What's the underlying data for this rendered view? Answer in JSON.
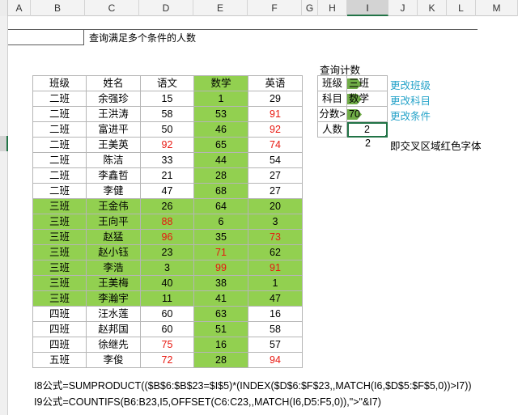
{
  "columns": [
    "A",
    "B",
    "C",
    "D",
    "E",
    "F",
    "G",
    "H",
    "I",
    "J",
    "K",
    "L",
    "M"
  ],
  "selected_column": "I",
  "caption": "查询满足多个条件的人数",
  "table": {
    "headers": [
      "班级",
      "姓名",
      "语文",
      "数学",
      "英语"
    ],
    "rows": [
      {
        "class": "二班",
        "name": "余强珍",
        "chinese": "15",
        "math": "1",
        "english": "29",
        "red": [],
        "highlight": false
      },
      {
        "class": "二班",
        "name": "王洪涛",
        "chinese": "58",
        "math": "53",
        "english": "91",
        "red": [
          "english"
        ],
        "highlight": false
      },
      {
        "class": "二班",
        "name": "富进平",
        "chinese": "50",
        "math": "46",
        "english": "92",
        "red": [
          "english"
        ],
        "highlight": false
      },
      {
        "class": "二班",
        "name": "王美英",
        "chinese": "92",
        "math": "65",
        "english": "74",
        "red": [
          "chinese",
          "english"
        ],
        "highlight": false
      },
      {
        "class": "二班",
        "name": "陈洁",
        "chinese": "33",
        "math": "44",
        "english": "54",
        "red": [],
        "highlight": false
      },
      {
        "class": "二班",
        "name": "李鑫哲",
        "chinese": "21",
        "math": "28",
        "english": "27",
        "red": [],
        "highlight": false
      },
      {
        "class": "二班",
        "name": "李健",
        "chinese": "47",
        "math": "68",
        "english": "27",
        "red": [],
        "highlight": false
      },
      {
        "class": "三班",
        "name": "王金伟",
        "chinese": "26",
        "math": "64",
        "english": "20",
        "red": [],
        "highlight": true
      },
      {
        "class": "三班",
        "name": "王向平",
        "chinese": "88",
        "math": "6",
        "english": "3",
        "red": [
          "chinese"
        ],
        "highlight": true
      },
      {
        "class": "三班",
        "name": "赵猛",
        "chinese": "96",
        "math": "35",
        "english": "73",
        "red": [
          "chinese",
          "english"
        ],
        "highlight": true
      },
      {
        "class": "三班",
        "name": "赵小钰",
        "chinese": "23",
        "math": "71",
        "english": "62",
        "red": [
          "math"
        ],
        "highlight": true
      },
      {
        "class": "三班",
        "name": "李浩",
        "chinese": "3",
        "math": "99",
        "english": "91",
        "red": [
          "math",
          "english"
        ],
        "highlight": true
      },
      {
        "class": "三班",
        "name": "王美梅",
        "chinese": "40",
        "math": "38",
        "english": "1",
        "red": [],
        "highlight": true
      },
      {
        "class": "三班",
        "name": "李瀚宇",
        "chinese": "11",
        "math": "41",
        "english": "47",
        "red": [],
        "highlight": true
      },
      {
        "class": "四班",
        "name": "汪水莲",
        "chinese": "60",
        "math": "63",
        "english": "16",
        "red": [],
        "highlight": false
      },
      {
        "class": "四班",
        "name": "赵邦国",
        "chinese": "60",
        "math": "51",
        "english": "58",
        "red": [],
        "highlight": false
      },
      {
        "class": "四班",
        "name": "徐继先",
        "chinese": "75",
        "math": "16",
        "english": "57",
        "red": [
          "chinese"
        ],
        "highlight": false
      },
      {
        "class": "五班",
        "name": "李俊",
        "chinese": "72",
        "math": "28",
        "english": "94",
        "red": [
          "chinese",
          "english"
        ],
        "highlight": false
      }
    ]
  },
  "query": {
    "title": "查询计数",
    "rows": [
      {
        "label": "班级",
        "value": "三班",
        "link": "更改班级"
      },
      {
        "label": "科目",
        "value": "数学",
        "link": "更改科目"
      },
      {
        "label": "分数>",
        "value": "70",
        "link": "更改条件"
      },
      {
        "label": "人数",
        "value": "2",
        "link": ""
      }
    ],
    "i9_value": "2",
    "i9_note": "即交叉区域红色字体"
  },
  "formulas": [
    "I8公式=SUMPRODUCT(($B$6:$B$23=$I$5)*(INDEX($D$6:$F$23,,MATCH(I6,$D$5:$F$5,0))>I7))",
    "I9公式=COUNTIFS(B6:B23,I5,OFFSET(C6:C23,,MATCH(I6,D5:F5,0)),\">\"&I7)"
  ],
  "colors": {
    "highlight": "#92d050",
    "red_text": "#e8170f",
    "link": "#26a3c9",
    "select_green": "#217346",
    "tag": "#70ad47"
  }
}
